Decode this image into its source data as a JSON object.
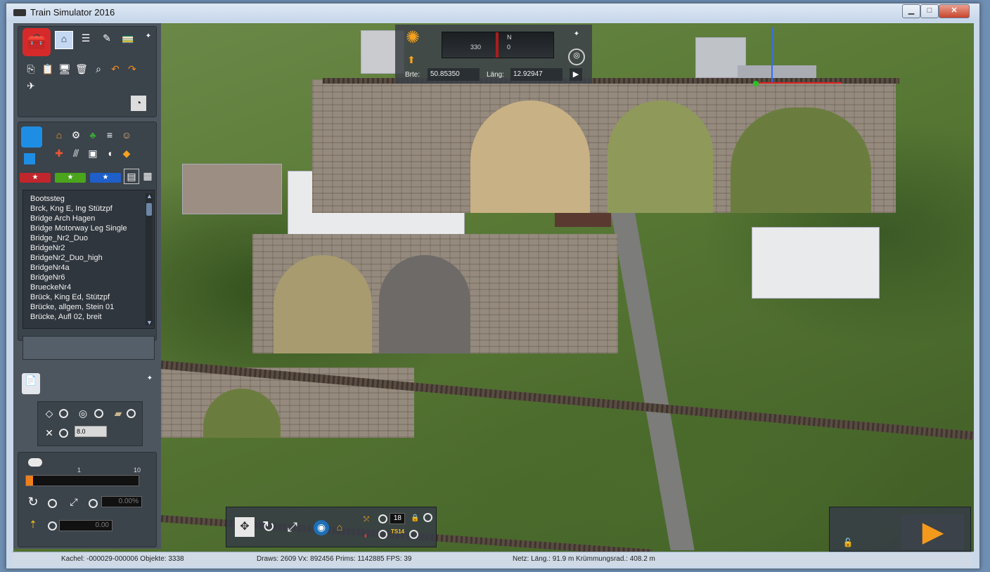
{
  "window": {
    "title": "Train Simulator 2016",
    "min_label": "▁",
    "max_label": "□",
    "close_label": "✕"
  },
  "compass": {
    "lat_label": "Brte:",
    "lat_value": "50.85350",
    "lon_label": "Läng:",
    "lon_value": "12.92947",
    "heading_left": "330",
    "heading_right": "0",
    "north": "N"
  },
  "object_list": {
    "items": [
      "Bootssteg",
      "Brck, Kng E, Ing Stützpf",
      "Bridge Arch Hagen",
      "Bridge Motorway Leg Single",
      "Bridge_Nr2_Duo",
      "BridgeNr2",
      "BridgeNr2_Duo_high",
      "BridgeNr4a",
      "BridgeNr6",
      "BrueckeNr4",
      "Brück, King Ed, Stützpf",
      "Brücke, allgem, Stein 01",
      "Brücke, Aufl 02, breit"
    ]
  },
  "snap_panel": {
    "value": "8.0"
  },
  "scale_panel": {
    "min": "1",
    "max": "10",
    "rotate_value": "0.00%",
    "height_value": "0.00",
    "slider_fraction": 0.0
  },
  "bottom_toolbar": {
    "number": "18",
    "ts14_label": "TS14"
  },
  "status": {
    "kachel": "Kachel: -000029-000006  Objekte: 3338",
    "draws": "Draws: 2609 Vx: 892456 Prims: 1142885 FPS: 39",
    "netz": "Netz:  Läng.:   91.9 m Krümmungsrad.: 408.2 m"
  },
  "colors": {
    "accent_red": "#c0262b",
    "accent_green": "#4aa51d",
    "accent_blue": "#1f5fc9",
    "play_orange": "#f39a1c"
  }
}
